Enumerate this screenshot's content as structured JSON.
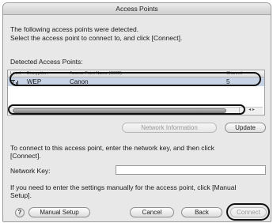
{
  "window": {
    "title": "Access Points"
  },
  "intro": {
    "line1": "The following access points were detected.",
    "line2": "Select the access point to connect to, and click [Connect]."
  },
  "detected_label": "Detected Access Points:",
  "table": {
    "columns": [
      "Level",
      "Encryption",
      "Access Point Name (SSID)",
      "Channel"
    ],
    "rows": [
      {
        "level_icon": "signal-strength-icon",
        "encryption": "WEP",
        "ssid": "Canon",
        "channel": "5"
      }
    ]
  },
  "scroll_arrows": "◂ ▸",
  "buttons": {
    "network_information": "Network Information",
    "update": "Update",
    "help": "?",
    "manual_setup": "Manual Setup",
    "cancel": "Cancel",
    "back": "Back",
    "connect": "Connect"
  },
  "key_instructions": {
    "line1": "To connect to this access point, enter the network key, and then click",
    "line2": "[Connect]."
  },
  "network_key": {
    "label": "Network Key:",
    "value": ""
  },
  "manual_note": {
    "line1": "If you need to enter the settings manually for the access point, click [Manual",
    "line2": "Setup]."
  },
  "colors": {
    "selected_row": "#c8d4e6",
    "annotation_ring": "#111111"
  }
}
